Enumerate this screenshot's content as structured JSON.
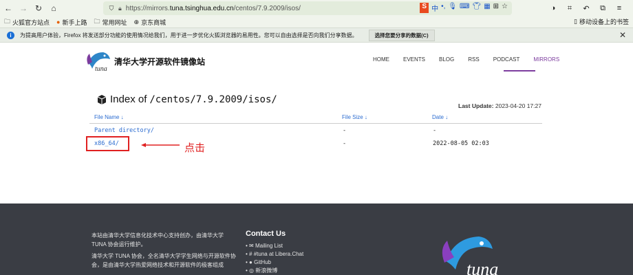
{
  "browser": {
    "url_prefix": "https://mirrors.",
    "url_domain": "tuna.tsinghua.edu.cn",
    "url_path": "/centos/7.9.2009/isos/",
    "bookmarks": [
      "火狐官方站点",
      "新手上路",
      "常用网址",
      "京东商城"
    ],
    "bookmark_right": "移动设备上的书签",
    "ext_labels": [
      "S",
      "中"
    ]
  },
  "notice": {
    "text": "为提高用户体验，Firefox 将发送部分功能的使用情况给我们，用于进一步优化火狐浏览器的易用性。您可以自由选择是否向我们分享数据。",
    "button": "选择您要分享的数据(C)"
  },
  "site": {
    "title": "清华大学开源软件镜像站",
    "logo_text": "tuna",
    "menu": [
      "HOME",
      "EVENTS",
      "BLOG",
      "RSS",
      "PODCAST",
      "MIRRORS"
    ]
  },
  "index": {
    "title": "Index of ",
    "path": "/centos/7.9.2009/isos/",
    "last_update_label": "Last Update:",
    "last_update_value": "2023-04-20 17:27",
    "columns": [
      "File Name ↓",
      "File Size ↓",
      "Date ↓"
    ],
    "rows": [
      {
        "name": "Parent directory/",
        "size": "-",
        "date": "-"
      },
      {
        "name": "x86_64/",
        "size": "-",
        "date": "2022-08-05 02:03"
      }
    ]
  },
  "annotation": {
    "label": "点击",
    "color": "#e02020"
  },
  "footer": {
    "about_1": "本站由清华大学信息化技术中心支持创办，由清华大学 TUNA 协会运行维护。",
    "about_2": "清华大学 TUNA 协会，全名清华大学学生网络与开源软件协会，是由清华大学热爱网络技术和开源软件的极客组成",
    "contact_title": "Contact Us",
    "contact_items": [
      "Mailing List",
      "#tuna at Libera.Chat",
      "GitHub",
      "新浪微博"
    ],
    "logo_text": "tuna"
  },
  "colors": {
    "accent": "#7c3c9e",
    "link": "#2a6bd0",
    "footer_bg": "#3a3d44"
  }
}
